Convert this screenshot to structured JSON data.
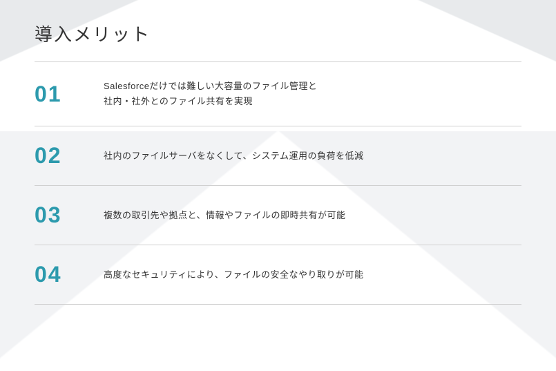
{
  "title": "導入メリット",
  "merits": [
    {
      "number": "01",
      "text": "Salesforceだけでは難しい大容量のファイル管理と\n社内・社外とのファイル共有を実現"
    },
    {
      "number": "02",
      "text": "社内のファイルサーバをなくして、システム運用の負荷を低減"
    },
    {
      "number": "03",
      "text": "複数の取引先や拠点と、情報やファイルの即時共有が可能"
    },
    {
      "number": "04",
      "text": "高度なセキュリティにより、ファイルの安全なやり取りが可能"
    }
  ]
}
